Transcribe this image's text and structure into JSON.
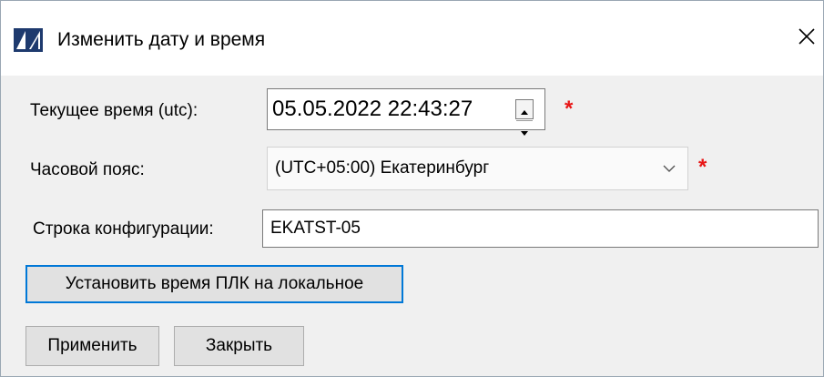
{
  "window": {
    "title": "Изменить дату и время",
    "icon": "app-logo-icon",
    "close_icon": "close-icon"
  },
  "form": {
    "current_time": {
      "label": "Текущее время (utc):",
      "value": "05.05.2022 22:43:27",
      "required_marker": "*"
    },
    "timezone": {
      "label": "Часовой пояс:",
      "selected": "(UTC+05:00) Екатеринбург",
      "required_marker": "*"
    },
    "config_string": {
      "label": "Строка конфигурации:",
      "value": "EKATST-05"
    }
  },
  "buttons": {
    "set_local_time": "Установить время ПЛК на локальное",
    "apply": "Применить",
    "close": "Закрыть"
  },
  "colors": {
    "required": "#e81515",
    "focus_border": "#0078d7",
    "logo_blue": "#1e3a6e"
  }
}
